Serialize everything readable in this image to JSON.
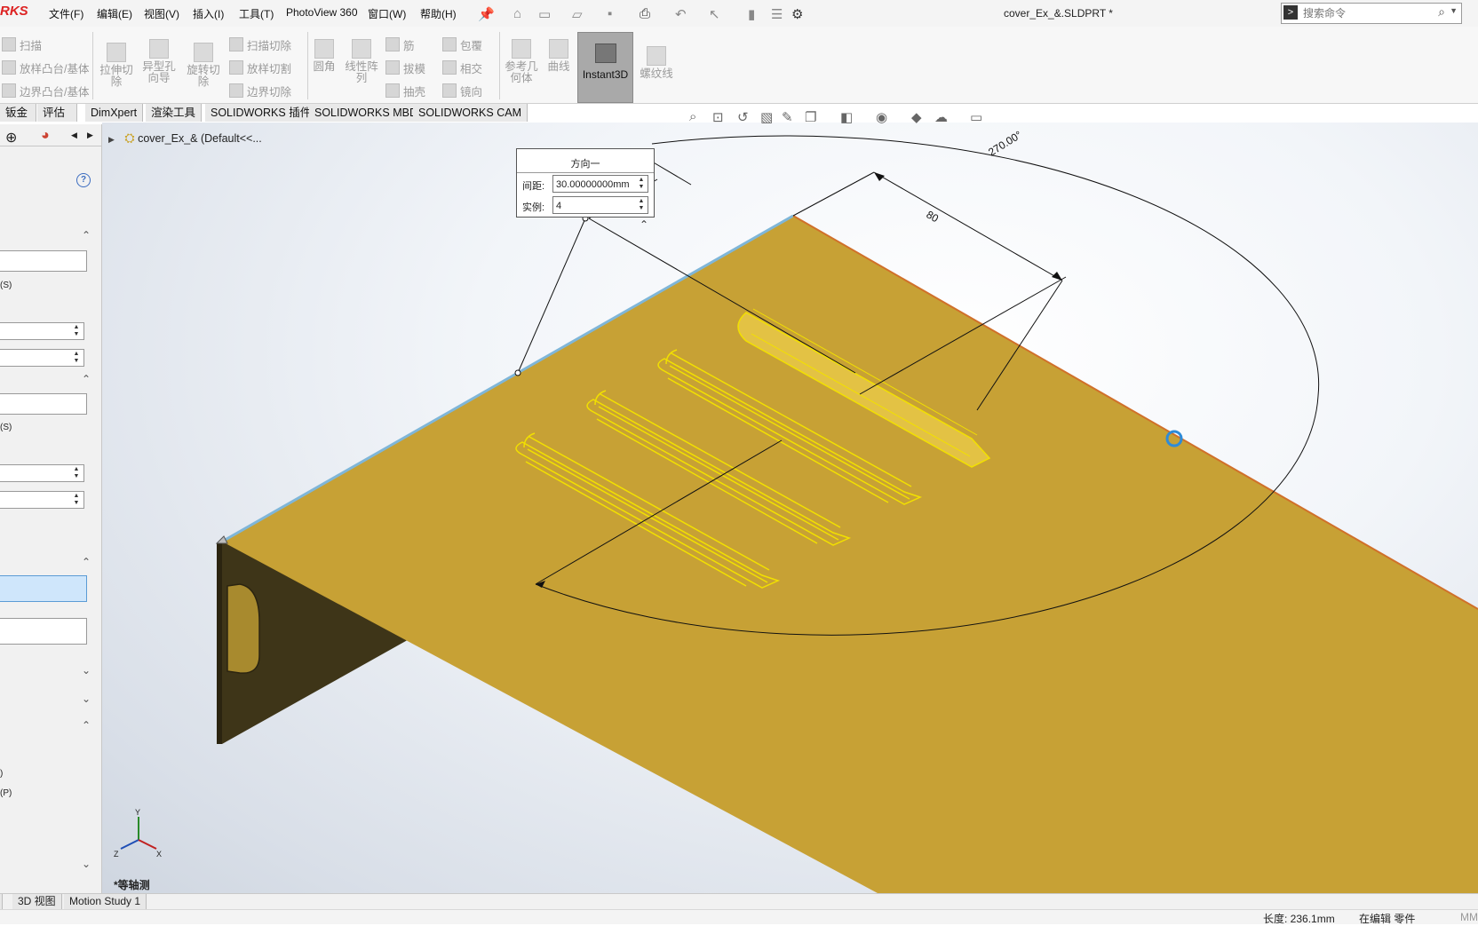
{
  "app": {
    "logo": "RKS",
    "document_title": "cover_Ex_&.SLDPRT *"
  },
  "menu": [
    "文件(F)",
    "编辑(E)",
    "视图(V)",
    "插入(I)",
    "工具(T)",
    "PhotoView 360",
    "窗口(W)",
    "帮助(H)"
  ],
  "search": {
    "placeholder": "搜索命令"
  },
  "ribbon": {
    "sweep": "扫描",
    "loft_boss": "放样凸台/基体",
    "boundary_boss": "边界凸台/基体",
    "extrude_cut": "拉伸切除",
    "hole_wizard": "异型孔向导",
    "revolve_cut": "旋转切除",
    "swept_cut": "扫描切除",
    "lofted_cut": "放样切割",
    "boundary_cut": "边界切除",
    "fillet": "圆角",
    "linear_pattern": "线性阵列",
    "rib": "筋",
    "draft": "拔模",
    "shell": "抽壳",
    "wrap": "包覆",
    "intersect": "相交",
    "mirror": "镜向",
    "ref_geometry": "参考几何体",
    "curves": "曲线",
    "instant3d": "Instant3D",
    "thread": "螺纹线"
  },
  "tabs": [
    "钣金",
    "评估",
    "DimXpert",
    "渲染工具",
    "SOLIDWORKS 插件",
    "SOLIDWORKS MBD",
    "SOLIDWORKS CAM"
  ],
  "left_panel": {
    "text_a": "(S)",
    "text_b": "(S)",
    "text_c": ")",
    "text_d": "(P)",
    "help": "?"
  },
  "tree": {
    "root": "cover_Ex_&  (Default<<..."
  },
  "dialog": {
    "title": "方向一",
    "spacing_label": "间距:",
    "spacing_value": "30.00000000mm",
    "instances_label": "实例:",
    "instances_value": "4"
  },
  "dimensions": {
    "angle": "270.00°",
    "length": "80"
  },
  "view": {
    "name": "*等轴测"
  },
  "triad": {
    "x": "X",
    "y": "Y",
    "z": "Z"
  },
  "bottom_tabs": [
    "3D 视图",
    "Motion Study 1"
  ],
  "status": {
    "length": "长度: 236.1mm",
    "mode": "在编辑 零件",
    "units": "MM"
  },
  "colors": {
    "part": "#c7a135",
    "highlight": "#f2e000",
    "accent_blue": "#2e8bd8"
  }
}
